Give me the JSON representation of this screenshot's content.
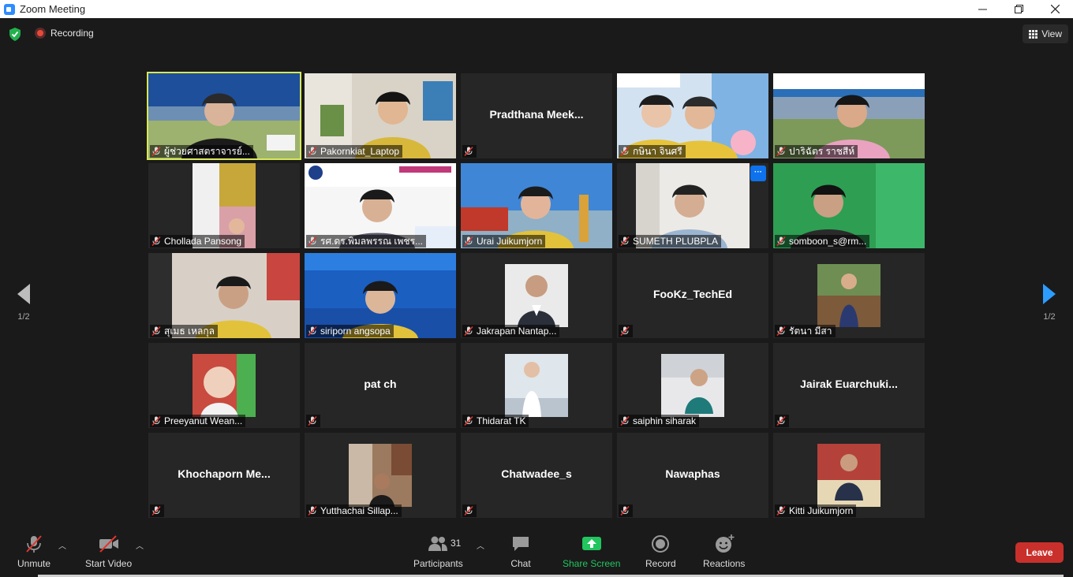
{
  "window": {
    "title": "Zoom Meeting"
  },
  "topbar": {
    "recording_label": "Recording",
    "view_label": "View"
  },
  "pager": {
    "left": "1/2",
    "right": "1/2"
  },
  "participants": [
    {
      "name": "ผู้ช่วยศาสตราจารย์...",
      "video": true,
      "scene": "slide-man"
    },
    {
      "name": "Pakornkiat_Laptop",
      "video": true,
      "scene": "room-man"
    },
    {
      "name": "Pradthana  Meek...",
      "video": false
    },
    {
      "name": "กษินา  จินศรี",
      "video": true,
      "scene": "slide-women"
    },
    {
      "name": "ปาริฉัตร  ราชสีห์",
      "video": true,
      "scene": "slide-woman"
    },
    {
      "name": "Chollada Pansong",
      "video": true,
      "scene": "portrait-small"
    },
    {
      "name": "รศ.ดร.พิมลพรรณ เพชร...",
      "video": true,
      "scene": "banner-woman"
    },
    {
      "name": "Urai Juikumjorn",
      "video": true,
      "scene": "sky-woman"
    },
    {
      "name": "SUMETH PLUBPLA",
      "video": true,
      "scene": "office-man"
    },
    {
      "name": "somboon_s@rm...",
      "video": true,
      "scene": "green-man"
    },
    {
      "name": "สุเมธ เหลกุล",
      "video": true,
      "scene": "room-man2"
    },
    {
      "name": "siriporn angsopa",
      "video": true,
      "scene": "blue-woman"
    },
    {
      "name": "Jakrapan Nantap...",
      "video": true,
      "scene": "photo-suit"
    },
    {
      "name": "FooKz_TechEd",
      "video": false
    },
    {
      "name": "รัตนา มีสา",
      "video": true,
      "scene": "photo-field"
    },
    {
      "name": "Preeyanut Wean...",
      "video": true,
      "scene": "photo-girl"
    },
    {
      "name": "pat ch",
      "video": false
    },
    {
      "name": "Thidarat TK",
      "video": true,
      "scene": "photo-white"
    },
    {
      "name": "saiphin siharak",
      "video": true,
      "scene": "photo-office"
    },
    {
      "name": "Jairak  Euarchuki...",
      "video": false
    },
    {
      "name": "Khochaporn  Me...",
      "video": false
    },
    {
      "name": "Yutthachai Sillap...",
      "video": true,
      "scene": "photo-street"
    },
    {
      "name": "Chatwadee_s",
      "video": false
    },
    {
      "name": "Nawaphas",
      "video": false
    },
    {
      "name": "Kitti Juikumjorn",
      "video": true,
      "scene": "photo-podium"
    }
  ],
  "toolbar": {
    "unmute": "Unmute",
    "start_video": "Start Video",
    "participants": "Participants",
    "participants_count": "31",
    "chat": "Chat",
    "share_screen": "Share Screen",
    "record": "Record",
    "reactions": "Reactions",
    "leave": "Leave"
  },
  "colors": {
    "share_green": "#22c55e",
    "leave_red": "#c9302c",
    "active_speaker": "#d8e85a",
    "accent_blue": "#2d8cff"
  }
}
